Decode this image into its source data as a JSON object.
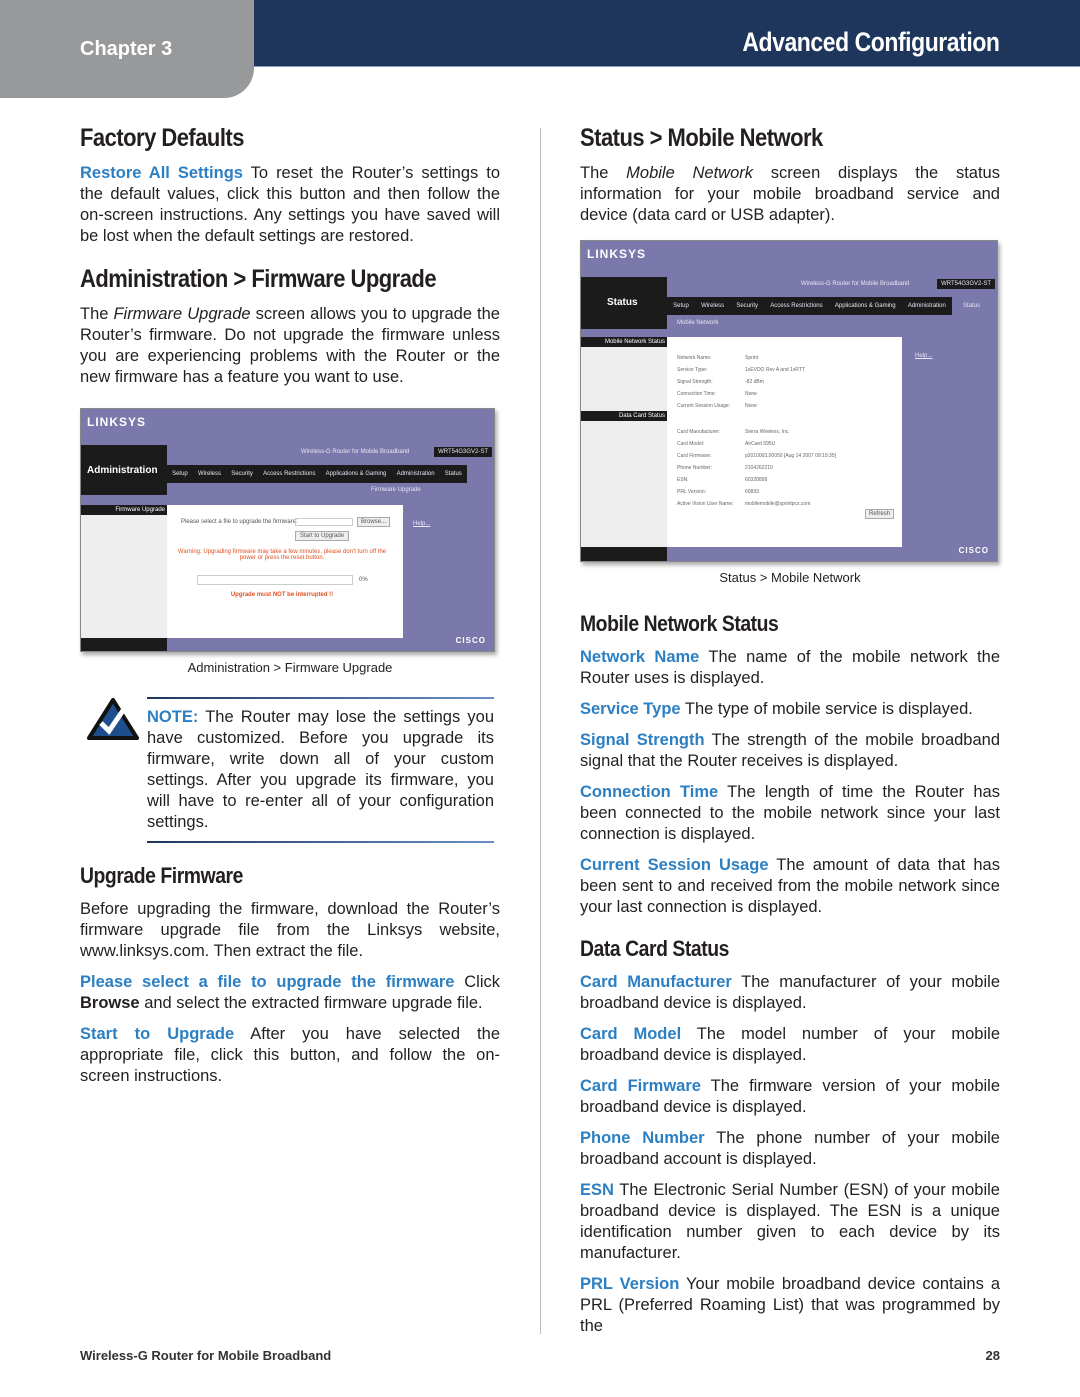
{
  "header": {
    "chapter": "Chapter 3",
    "title": "Advanced Configuration"
  },
  "left": {
    "factory": {
      "heading": "Factory Defaults",
      "term": "Restore All Settings",
      "text": " To reset the Router’s settings to the default values, click this button and then follow the on-screen instructions. Any settings you have saved will be lost when the default settings are restored."
    },
    "admin": {
      "heading": "Administration > Firmware Upgrade",
      "p_pre": "The ",
      "p_em": "Firmware Upgrade",
      "p_post": " screen allows you to upgrade the Router’s firmware. Do not upgrade the firmware unless you are experiencing problems with the Router or the new firmware has a feature you want to use."
    },
    "shot": {
      "logo": "LINKSYS",
      "section": "Administration",
      "product": "Wireless-G Router for Mobile Broadband",
      "model": "WRT54G3GV2-ST",
      "tabs": [
        "Setup",
        "Wireless",
        "Security",
        "Access Restrictions",
        "Applications & Gaming",
        "Administration",
        "Status"
      ],
      "subtab": "Firmware Upgrade",
      "side_item": "Firmware Upgrade",
      "select_label": "Please select a file to upgrade the firmware:",
      "browse": "Browse...",
      "start": "Start to Upgrade",
      "warning": "Warning: Upgrading firmware may take a few minutes, please don't turn off the power or press the reset button.",
      "percent": "0%",
      "progress": 0,
      "interrupt": "Upgrade must NOT be interrupted !!",
      "help": "Help...",
      "cisco": "CISCO"
    },
    "caption": "Administration > Firmware Upgrade",
    "note": {
      "label": "NOTE:",
      "text": " The Router may lose the settings you have customized. Before you upgrade its firmware, write down all of your custom settings. After you upgrade its firmware, you will have to re-enter all of your configuration settings."
    },
    "upgrade": {
      "heading": "Upgrade Firmware",
      "intro": "Before upgrading the firmware, download the Router’s firmware upgrade file from the Linksys website, www.linksys.com. Then extract the file.",
      "p1_term": "Please select a file to upgrade the firmware",
      "p1_a": " Click ",
      "p1_b": "Browse",
      "p1_c": " and select the extracted firmware upgrade file.",
      "p2_term": "Start to Upgrade",
      "p2_text": " After you have selected the appropriate file, click this button, and follow the on-screen instructions."
    }
  },
  "right": {
    "status": {
      "heading": "Status > Mobile Network",
      "p_pre": "The ",
      "p_em": "Mobile Network",
      "p_post": " screen displays the status information for your mobile broadband service and device (data card or USB adapter)."
    },
    "shot": {
      "logo": "LINKSYS",
      "section": "Status",
      "product": "Wireless-G Router for Mobile Broadband",
      "model": "WRT54G3GV2-ST",
      "tabs": [
        "Setup",
        "Wireless",
        "Security",
        "Access Restrictions",
        "Applications & Gaming",
        "Administration",
        "Status"
      ],
      "subtab": "Mobile Network",
      "side1": "Mobile Network Status",
      "side2": "Data Card Status",
      "rows1": [
        [
          "Network Name:",
          "Sprint"
        ],
        [
          "Service Type:",
          "1xEVDO Rev A and 1xRTT"
        ],
        [
          "Signal Strength:",
          "-82 dBm"
        ],
        [
          "Connection Time:",
          "None"
        ],
        [
          "Current Session Usage:",
          "None"
        ]
      ],
      "rows2": [
        [
          "Card Manufacturer:",
          "Sierra Wireless, Inc."
        ],
        [
          "Card Model:",
          "AirCard 595U"
        ],
        [
          "Card Firmware:",
          "p2010003,00050 [Aug 14 2007 09:10:35]"
        ],
        [
          "Phone Number:",
          "2104262210"
        ],
        [
          "ESN:",
          "60328898"
        ],
        [
          "PRL Version:",
          "60893"
        ],
        [
          "Active Vision User Name:",
          "mobilemobile@sprintpcs.com"
        ]
      ],
      "refresh": "Refresh",
      "help": "Help...",
      "cisco": "CISCO"
    },
    "caption": "Status > Mobile Network",
    "mns": {
      "heading": "Mobile Network Status",
      "items": [
        {
          "term": "Network Name",
          "text": " The name of the mobile network the Router uses is displayed."
        },
        {
          "term": "Service Type",
          "text": " The type of mobile service is displayed."
        },
        {
          "term": "Signal Strength",
          "text": " The strength of the mobile broadband signal that the Router receives is displayed."
        },
        {
          "term": "Connection Time",
          "text": " The length of time the Router has been connected to the mobile network since your last connection is displayed."
        },
        {
          "term": "Current Session Usage",
          "text": " The amount of data that has been sent to and received from the mobile network since your last connection is displayed."
        }
      ]
    },
    "dcs": {
      "heading": "Data Card Status",
      "items": [
        {
          "term": "Card Manufacturer",
          "text": " The manufacturer of your mobile broadband device is displayed."
        },
        {
          "term": "Card Model",
          "text": " The model number of your mobile broadband device is displayed."
        },
        {
          "term": "Card Firmware",
          "text": " The firmware version of your mobile broadband device is displayed."
        },
        {
          "term": "Phone Number",
          "text": " The phone number of your mobile broadband account is displayed."
        },
        {
          "term": "ESN",
          "text": " The Electronic Serial Number (ESN) of your mobile broadband device is displayed. The ESN is a unique identification number given to each device by its manufacturer."
        },
        {
          "term": "PRL Version",
          "text": " Your mobile broadband device contains a PRL (Preferred Roaming List) that was programmed by the"
        }
      ]
    }
  },
  "footer": {
    "product": "Wireless-G Router for Mobile Broadband",
    "page": "28"
  },
  "colors": {
    "header": "#1e365c",
    "chapter_tab": "#98999b",
    "term": "#2c7fc2",
    "router_ui": "#7b78ab"
  }
}
